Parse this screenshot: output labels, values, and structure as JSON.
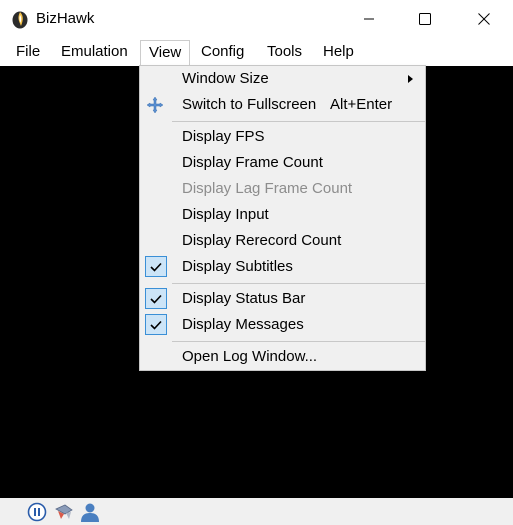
{
  "window": {
    "title": "BizHawk"
  },
  "menubar": {
    "items": [
      {
        "label": "File"
      },
      {
        "label": "Emulation"
      },
      {
        "label": "View"
      },
      {
        "label": "Config"
      },
      {
        "label": "Tools"
      },
      {
        "label": "Help"
      }
    ]
  },
  "view_menu": {
    "window_size": "Window Size",
    "switch_fullscreen": "Switch to Fullscreen",
    "switch_fullscreen_shortcut": "Alt+Enter",
    "display_fps": "Display FPS",
    "display_frame_count": "Display Frame Count",
    "display_lag_frame_count": "Display Lag Frame Count",
    "display_input": "Display Input",
    "display_rerecord_count": "Display Rerecord Count",
    "display_subtitles": "Display Subtitles",
    "display_status_bar": "Display Status Bar",
    "display_messages": "Display Messages",
    "open_log_window": "Open Log Window..."
  },
  "checked": {
    "display_subtitles": true,
    "display_status_bar": true,
    "display_messages": true
  },
  "icons": {
    "app": "bizhawk-logo-icon",
    "fullscreen": "move-arrows-icon",
    "status": [
      "pause-icon",
      "controller-icon",
      "user-icon"
    ]
  },
  "colors": {
    "display_bg": "#000000",
    "check_bg": "#cce4f7",
    "check_border": "#3a8fd6",
    "menu_bg": "#f0f0f0",
    "disabled_text": "#8d8d8d"
  }
}
